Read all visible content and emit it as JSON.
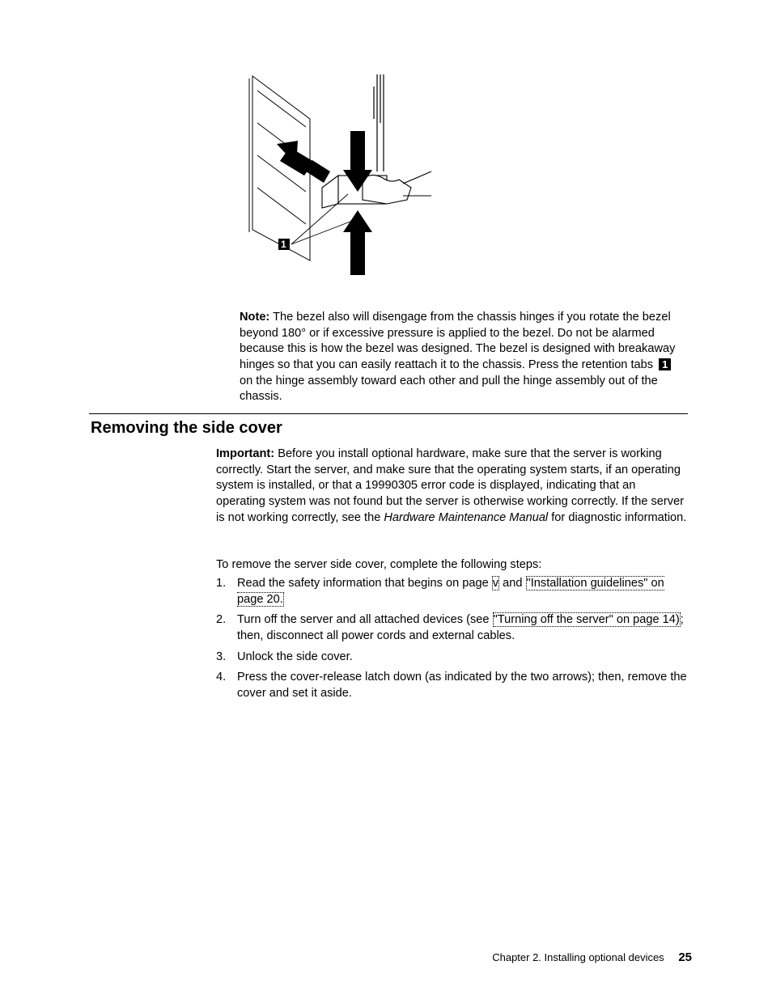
{
  "figure": {
    "callout": "1"
  },
  "note": {
    "label": "Note:",
    "text_before_callout": "The bezel also will disengage from the chassis hinges if you rotate the bezel beyond 180° or if excessive pressure is applied to the bezel. Do not be alarmed because this is how the bezel was designed. The bezel is designed with breakaway hinges so that you can easily reattach it to the chassis. Press the retention tabs ",
    "callout": "1",
    "text_after_callout": " on the hinge assembly toward each other and pull the hinge assembly out of the chassis."
  },
  "section": {
    "heading": "Removing the side cover"
  },
  "important": {
    "label": "Important:",
    "text_1": " Before you install optional hardware, make sure that the server is working correctly. Start the server, and make sure that the operating system starts, if an operating system is installed, or that a 19990305 error code is displayed, indicating that an operating system was not found but the server is otherwise working correctly. If the server is not working correctly, see the ",
    "italic": "Hardware Maintenance Manual",
    "text_2": " for diagnostic information."
  },
  "steps_intro": "To remove the server side cover, complete the following steps:",
  "steps": [
    {
      "num": "1.",
      "parts": [
        {
          "t": "text",
          "v": "Read the safety information that begins on page "
        },
        {
          "t": "xref",
          "v": "v"
        },
        {
          "t": "text",
          "v": " and "
        },
        {
          "t": "xref",
          "v": "\"Installation guidelines\" on page 20."
        }
      ]
    },
    {
      "num": "2.",
      "parts": [
        {
          "t": "text",
          "v": "Turn off the server and all attached devices (see "
        },
        {
          "t": "xref",
          "v": "\"Turning off the server\" on page 14)"
        },
        {
          "t": "text",
          "v": "; then, disconnect all power cords and external cables."
        }
      ]
    },
    {
      "num": "3.",
      "parts": [
        {
          "t": "text",
          "v": "Unlock the side cover."
        }
      ]
    },
    {
      "num": "4.",
      "parts": [
        {
          "t": "text",
          "v": "Press the cover-release latch down (as indicated by the two arrows); then, remove the cover and set it aside."
        }
      ]
    }
  ],
  "footer": {
    "chapter": "Chapter 2. Installing optional devices",
    "page": "25"
  }
}
